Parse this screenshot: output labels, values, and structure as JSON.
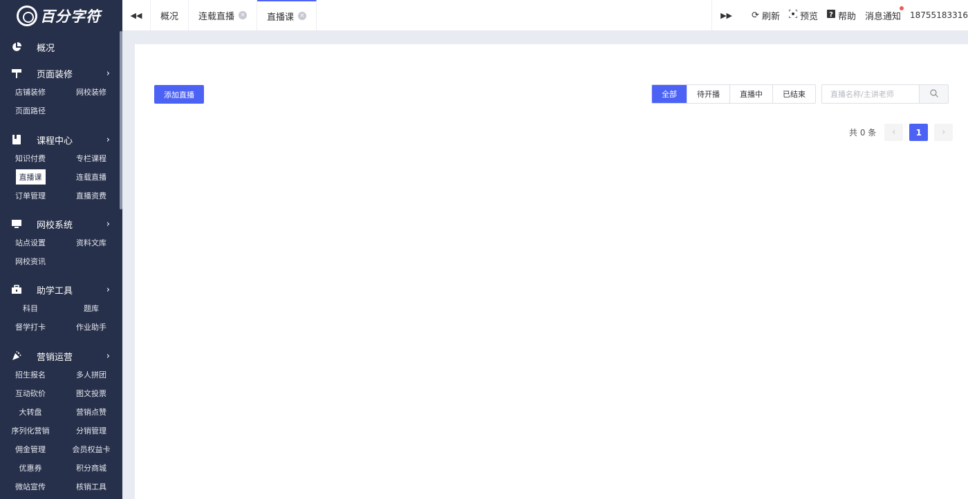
{
  "brand": {
    "name": "百分字符"
  },
  "sidebar": {
    "groups": [
      {
        "label": "概况",
        "icon": "pie-chart-icon",
        "items": []
      },
      {
        "label": "页面装修",
        "icon": "paint-roller-icon",
        "items": [
          "店铺装修",
          "网校装修",
          "页面路径"
        ]
      },
      {
        "label": "课程中心",
        "icon": "book-icon",
        "items": [
          "知识付费",
          "专栏课程",
          "直播课",
          "连载直播",
          "订单管理",
          "直播资费"
        ]
      },
      {
        "label": "网校系统",
        "icon": "monitor-icon",
        "items": [
          "站点设置",
          "资料文库",
          "网校资讯"
        ]
      },
      {
        "label": "助学工具",
        "icon": "toolbox-icon",
        "items": [
          "科目",
          "题库",
          "督学打卡",
          "作业助手"
        ]
      },
      {
        "label": "营销运营",
        "icon": "party-popper-icon",
        "items": [
          "招生报名",
          "多人拼团",
          "互动砍价",
          "图文投票",
          "大转盘",
          "营销点赞",
          "序列化营销",
          "分销管理",
          "佣金管理",
          "会员权益卡",
          "优惠券",
          "积分商城",
          "微站宣传",
          "核销工具"
        ]
      }
    ],
    "active_item": "直播课"
  },
  "tabs": [
    {
      "label": "概况",
      "closable": false
    },
    {
      "label": "连载直播",
      "closable": true
    },
    {
      "label": "直播课",
      "closable": true,
      "active": true
    }
  ],
  "header": {
    "refresh": "刷新",
    "preview": "预览",
    "help": "帮助",
    "notifications": "消息通知",
    "user_phone": "18755183316"
  },
  "main": {
    "add_button": "添加直播",
    "filters": [
      "全部",
      "待开播",
      "直播中",
      "已结束"
    ],
    "active_filter": "全部",
    "search_placeholder": "直播名称/主讲老师",
    "pager": {
      "total_text": "共 0 条",
      "current_page": "1",
      "prev": "‹",
      "next": "›"
    }
  },
  "colors": {
    "sidebar_bg": "#27304a",
    "accent": "#4c62f5",
    "notify_dot": "#f15858"
  }
}
